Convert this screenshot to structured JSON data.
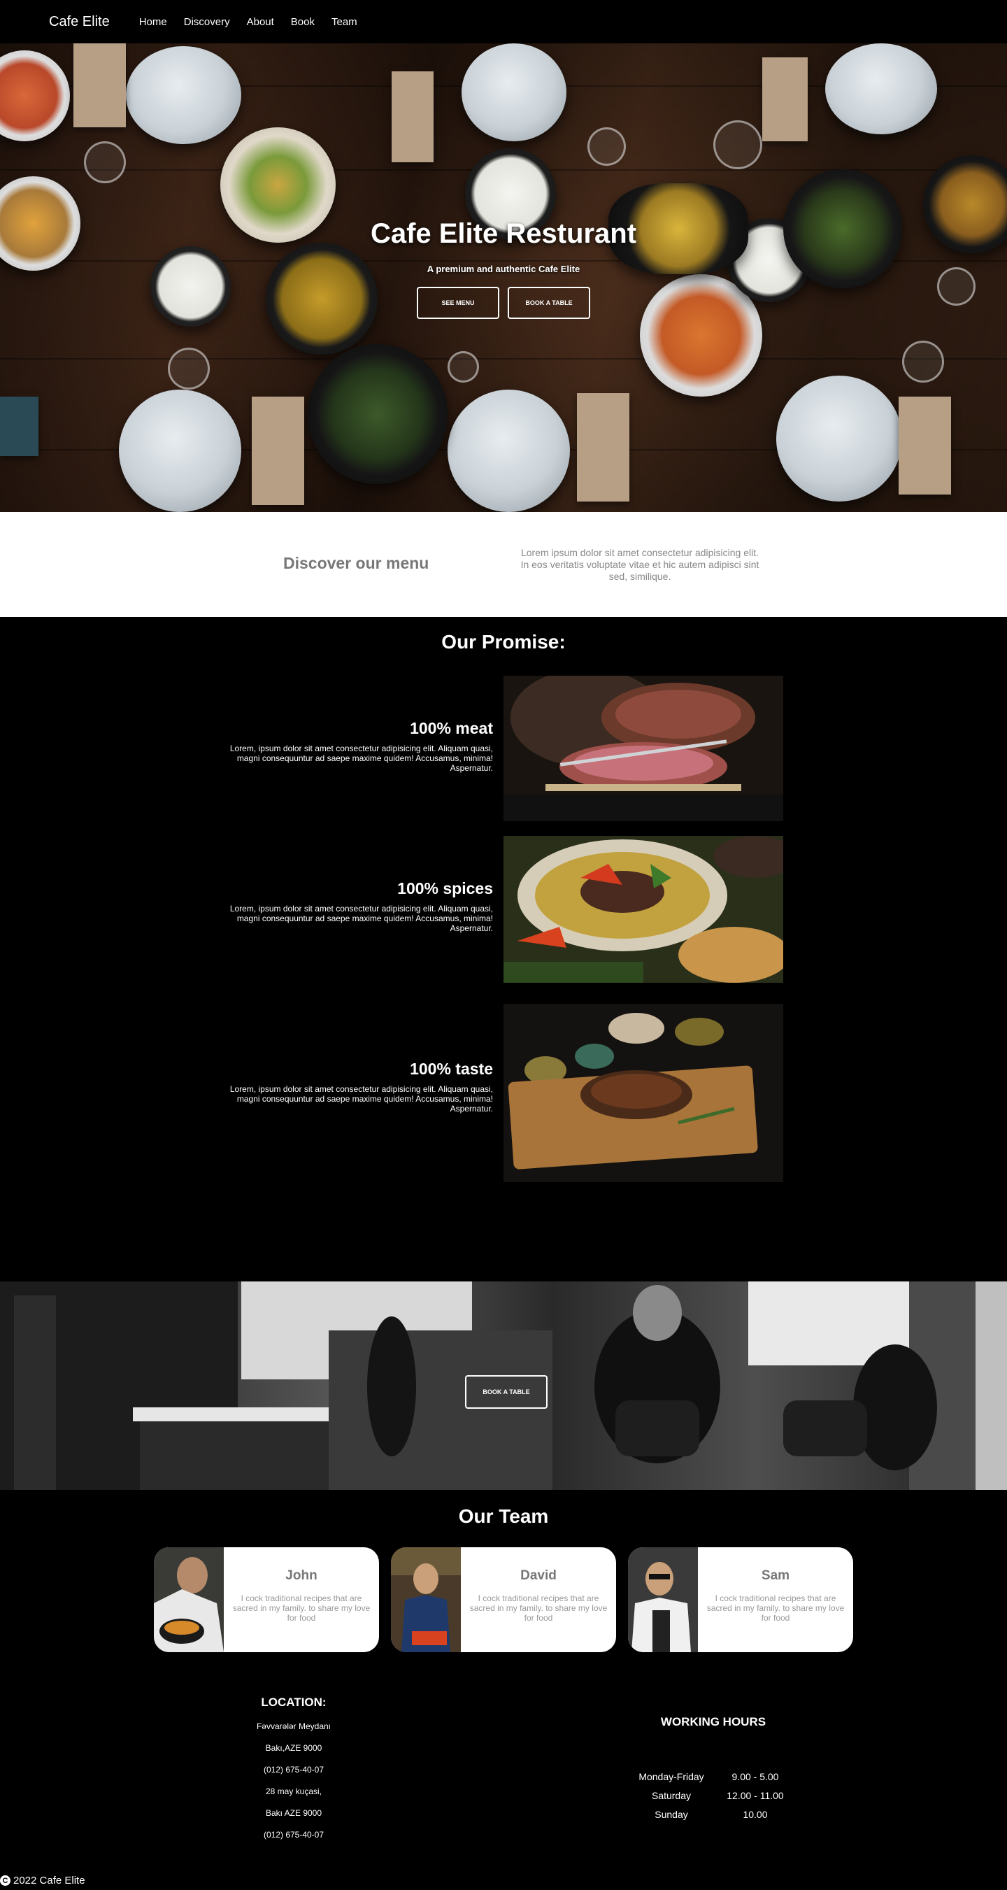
{
  "nav": {
    "brand": "Cafe Elite",
    "links": [
      "Home",
      "Discovery",
      "About",
      "Book",
      "Team"
    ]
  },
  "hero": {
    "title": "Cafe Elite Resturant",
    "subtitle": "A premium and authentic Cafe Elite",
    "see_menu": "SEE MENU",
    "book_table": "BOOK A TABLE"
  },
  "discover": {
    "title": "Discover our menu",
    "text": "Lorem ipsum dolor sit amet consectetur adipisicing elit. In eos veritatis voluptate vitae et hic autem adipisci sint sed, similique."
  },
  "promise": {
    "title": "Our Promise:",
    "items": [
      {
        "heading": "100% meat",
        "body": "Lorem, ipsum dolor sit amet consectetur adipisicing elit. Aliquam quasi, magni consequuntur ad saepe maxime quidem! Accusamus, minima! Aspernatur."
      },
      {
        "heading": "100% spices",
        "body": "Lorem, ipsum dolor sit amet consectetur adipisicing elit. Aliquam quasi, magni consequuntur ad saepe maxime quidem! Accusamus, minima! Aspernatur."
      },
      {
        "heading": "100% taste",
        "body": "Lorem, ipsum dolor sit amet consectetur adipisicing elit. Aliquam quasi, magni consequuntur ad saepe maxime quidem! Accusamus, minima! Aspernatur."
      }
    ]
  },
  "band": {
    "book_table": "BOOK A TABLE"
  },
  "team": {
    "title": "Our Team",
    "members": [
      {
        "name": "John",
        "desc": "I cock traditional recipes that are sacred in my family. to share my love for food"
      },
      {
        "name": "David",
        "desc": "I cock traditional recipes that are sacred in my family. to share my love for food"
      },
      {
        "name": "Sam",
        "desc": "I cock traditional recipes that are sacred in my family. to share my love for food"
      }
    ]
  },
  "location": {
    "title": "LOCATION:",
    "lines": [
      "Fəvvarələr Meydanı",
      "Bakı,AZE 9000",
      "(012) 675-40-07",
      "28 may kuçasi,",
      "Bakı AZE 9000",
      "(012) 675-40-07"
    ]
  },
  "hours": {
    "title": "WORKING HOURS",
    "rows": [
      {
        "day": "Monday-Friday",
        "time": "9.00 - 5.00"
      },
      {
        "day": "Saturday",
        "time": "12.00 - 11.00"
      },
      {
        "day": "Sunday",
        "time": "10.00"
      }
    ]
  },
  "footer": {
    "copyright": "2022 Cafe Elite",
    "copy_symbol": "C"
  }
}
